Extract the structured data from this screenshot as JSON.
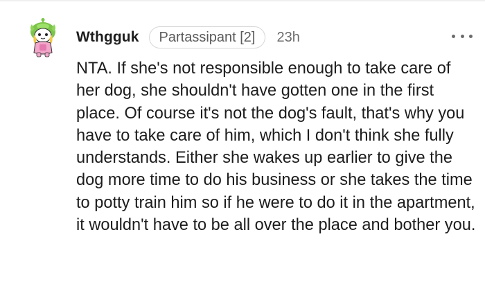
{
  "comment": {
    "username": "Wthgguk",
    "flair": "Partassipant [2]",
    "time": "23h",
    "more_icon": "more-horizontal-icon",
    "avatar_icon": "snoo-avatar-icon",
    "body": "NTA. If she's not responsible enough to take care of her dog, she shouldn't have gotten one in the first place. Of course it's not the dog's fault, that's why you have to take care of him, which I don't think she fully understands. Either she wakes up earlier to give the dog more time to do his business or she takes the time to potty train him so if he were to do it in the apartment, it wouldn't have to be all over the place and bother you."
  },
  "colors": {
    "text": "#1c1c1c",
    "meta": "#6b6b6b",
    "flair_border": "#d7d7d7",
    "avatar_green": "#7cc44a"
  }
}
